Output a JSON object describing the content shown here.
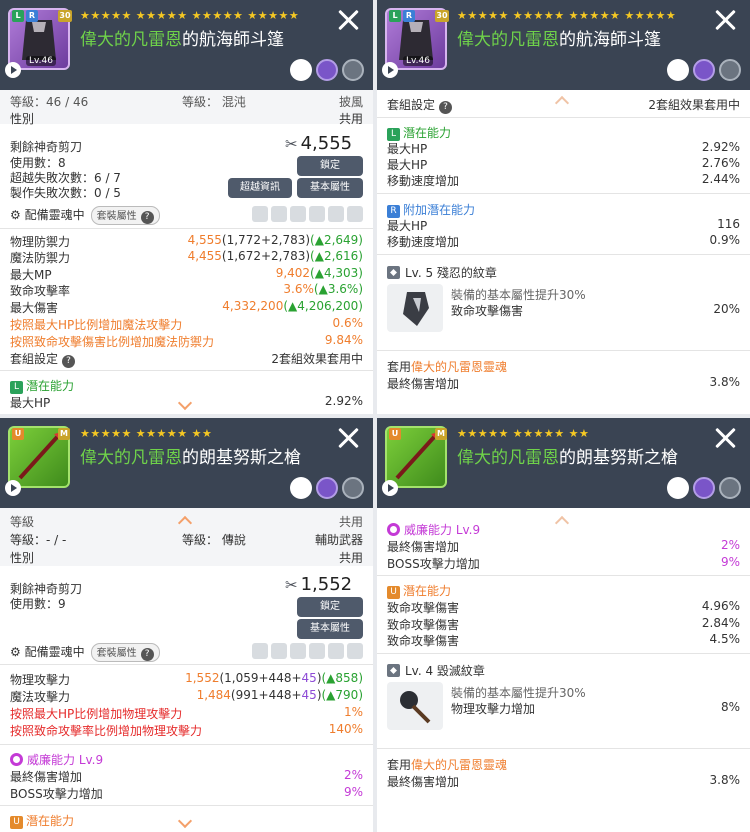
{
  "panel1": {
    "stars": "★★★★★ ★★★★★ ★★★★★ ★★★★★",
    "star_count": "30",
    "title_prefix": "偉大的凡雷恩",
    "title_suffix": "的航海師斗篷",
    "item_level": "Lv.46",
    "top_left": "等級：46 / 46",
    "top_mid": "等級： 混沌",
    "top_right": "披風",
    "gender_label": "性別",
    "gender_value": "共用",
    "scissors_label": "剩餘神奇剪刀",
    "uses_label": "使用數：8",
    "transcend_label": "超越失敗次數：6 / 7",
    "craft_label": "製作失敗次數：0 / 5",
    "shard_value": "4,555",
    "btn_lock": "鎖定",
    "btn_transcend": "超越資訊",
    "btn_base": "基本屬性",
    "soul_label": "配備靈魂中",
    "set_pill": "套裝屬性",
    "stats": [
      {
        "label": "物理防禦力",
        "main": "4,555",
        "paren": "(1,772+2,783)",
        "delta": "(▲2,649)"
      },
      {
        "label": "魔法防禦力",
        "main": "4,455",
        "paren": "(1,672+2,783)",
        "delta": "(▲2,616)"
      },
      {
        "label": "最大MP",
        "main": "9,402",
        "paren": "",
        "delta": "(▲4,303)"
      },
      {
        "label": "致命攻擊率",
        "main": "3.6%",
        "paren": "",
        "delta": "(▲3.6%)"
      },
      {
        "label": "最大傷害",
        "main": "4,332,200",
        "paren": "",
        "delta": "(▲4,206,200)"
      }
    ],
    "special1_label": "按照最大HP比例增加魔法攻擊力",
    "special1_value": "0.6%",
    "special2_label": "按照致命攻擊傷害比例增加魔法防禦力",
    "special2_value": "9.84%",
    "set_label": "套組設定",
    "set_value": "2套組效果套用中",
    "potential_tag": "L",
    "potential_label": "潛在能力",
    "hp_label": "最大HP",
    "hp_value": "2.92%"
  },
  "panel2": {
    "stars": "★★★★★ ★★★★★ ★★★★★ ★★★★★",
    "star_count": "30",
    "title_prefix": "偉大的凡雷恩",
    "title_suffix": "的航海師斗篷",
    "item_level": "Lv.46",
    "set_label": "套組設定",
    "set_value": "2套組效果套用中",
    "potential_tag": "L",
    "potential_label": "潛在能力",
    "potential": [
      {
        "label": "最大HP",
        "value": "2.92%"
      },
      {
        "label": "最大HP",
        "value": "2.76%"
      },
      {
        "label": "移動速度增加",
        "value": "2.44%"
      }
    ],
    "additional_tag": "R",
    "additional_label": "附加潛在能力",
    "additional": [
      {
        "label": "最大HP",
        "value": "116"
      },
      {
        "label": "移動速度增加",
        "value": "0.9%"
      }
    ],
    "emblem_title": "Lv. 5 殘忍的紋章",
    "emblem_desc": "裝備的基本屬性提升30%",
    "emblem_stat_label": "致命攻擊傷害",
    "emblem_stat_value": "20%",
    "soul_prefix": "套用",
    "soul_name": "偉大的凡雷恩靈魂",
    "soul_stat_label": "最終傷害增加",
    "soul_stat_value": "3.8%"
  },
  "panel3": {
    "stars": "★★★★★ ★★★★★ ★★",
    "title_prefix": "偉大的凡雷恩",
    "title_suffix": "的朗基努斯之槍",
    "top_left": "等級",
    "top_right": "共用",
    "level_label": "等級：- / -",
    "grade_label": "等級： 傳說",
    "type_value": "輔助武器",
    "gender_label": "性別",
    "gender_value": "共用",
    "scissors_label": "剩餘神奇剪刀",
    "uses_label": "使用數：9",
    "shard_value": "1,552",
    "btn_lock": "鎖定",
    "btn_base": "基本屬性",
    "soul_label": "配備靈魂中",
    "set_pill": "套裝屬性",
    "stats": [
      {
        "label": "物理攻擊力",
        "main": "1,552",
        "paren_a": "(1,059+448+",
        "paren_b": "45",
        "paren_c": ")",
        "delta": "(▲858)"
      },
      {
        "label": "魔法攻擊力",
        "main": "1,484",
        "paren_a": "(991+448+",
        "paren_b": "45",
        "paren_c": ")",
        "delta": "(▲790)"
      }
    ],
    "special1_label": "按照最大HP比例增加物理攻擊力",
    "special1_value": "1%",
    "special2_label": "按照致命攻擊率比例增加物理攻擊力",
    "special2_value": "140%",
    "ability_label": "威廉能力 Lv.9",
    "ability": [
      {
        "label": "最終傷害增加",
        "value": "2%"
      },
      {
        "label": "BOSS攻擊力增加",
        "value": "9%"
      }
    ],
    "potential_tag": "U",
    "potential_label": "潛在能力"
  },
  "panel4": {
    "stars": "★★★★★ ★★★★★ ★★",
    "title_prefix": "偉大的凡雷恩",
    "title_suffix": "的朗基努斯之槍",
    "ability_label": "威廉能力 Lv.9",
    "ability": [
      {
        "label": "最終傷害增加",
        "value": "2%"
      },
      {
        "label": "BOSS攻擊力增加",
        "value": "9%"
      }
    ],
    "potential_tag": "U",
    "potential_label": "潛在能力",
    "potential": [
      {
        "label": "致命攻擊傷害",
        "value": "4.96%"
      },
      {
        "label": "致命攻擊傷害",
        "value": "2.84%"
      },
      {
        "label": "致命攻擊傷害",
        "value": "4.5%"
      }
    ],
    "emblem_title": "Lv. 4 毀滅紋章",
    "emblem_desc": "裝備的基本屬性提升30%",
    "emblem_stat_label": "物理攻擊力增加",
    "emblem_stat_value": "8%",
    "soul_prefix": "套用",
    "soul_name": "偉大的凡雷恩靈魂",
    "soul_stat_label": "最終傷害增加",
    "soul_stat_value": "3.8%"
  },
  "colors": {
    "header": "#3a4453",
    "accent_orange": "#ef7d2d",
    "accent_green": "#2aa232",
    "accent_red": "#e52b2b",
    "accent_purple": "#c43ad6"
  },
  "icons": [
    "close-icon",
    "play-icon",
    "hand-pointer-icon",
    "scales-icon",
    "gear-compare-icon",
    "info-icon",
    "chevron-up-icon",
    "chevron-down-icon",
    "scissors-icon",
    "soul-icon"
  ]
}
